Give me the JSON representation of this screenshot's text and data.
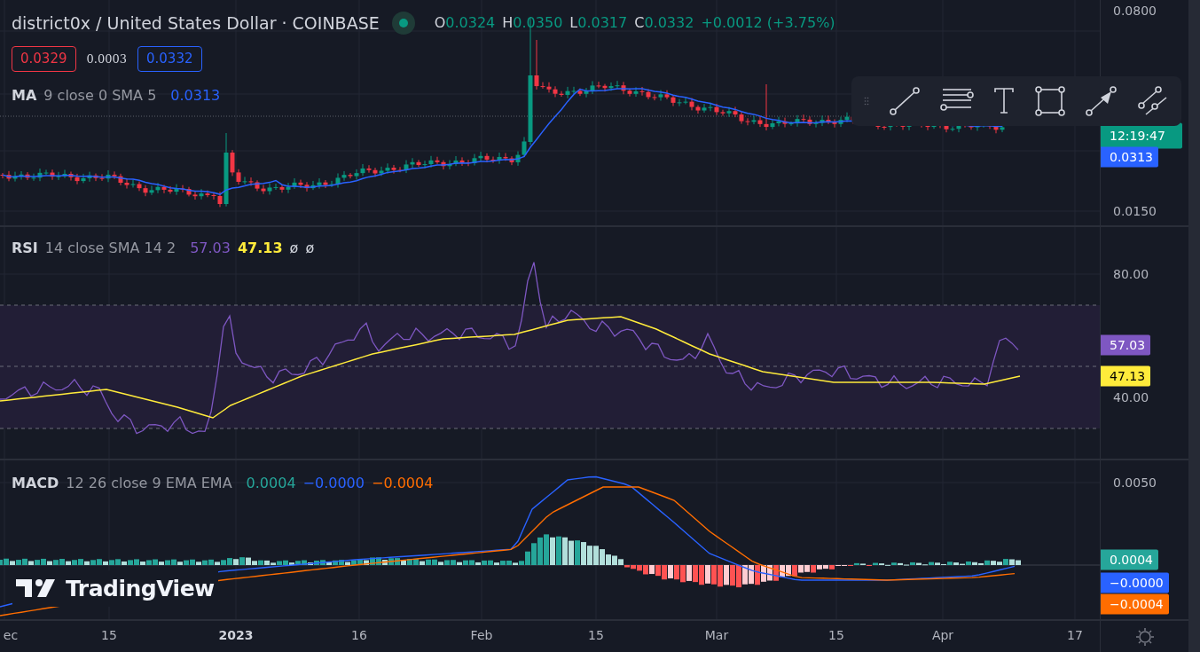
{
  "header": {
    "title": "district0x / United States Dollar · COINBASE",
    "live": true,
    "ohlc": [
      {
        "label": "O",
        "value": "0.0324"
      },
      {
        "label": "H",
        "value": "0.0350"
      },
      {
        "label": "L",
        "value": "0.0317"
      },
      {
        "label": "C",
        "value": "0.0332"
      }
    ],
    "change": "+0.0012 (+3.75%)"
  },
  "quote": {
    "sell": "0.0329",
    "spread": "0.0003",
    "buy": "0.0332"
  },
  "panes": [
    {
      "kind": "price",
      "legend": {
        "name": "MA",
        "params": "9 close 0 SMA 5",
        "values": [
          {
            "text": "0.0313",
            "color": "#2962ff"
          }
        ]
      },
      "axis": {
        "ticks": [
          "0.0800",
          "0.0150"
        ],
        "tags": [
          {
            "text": "12:19:47",
            "color": "#089981"
          },
          {
            "text": "0.0313",
            "color": "#2962ff"
          }
        ]
      }
    },
    {
      "kind": "rsi",
      "legend": {
        "name": "RSI",
        "params": "14 close SMA 14 2",
        "values": [
          {
            "text": "57.03",
            "color": "#7e57c2"
          },
          {
            "text": "47.13",
            "color": "#ffeb3b"
          },
          {
            "text": "ø",
            "color": "#d1d4dc"
          },
          {
            "text": "ø",
            "color": "#d1d4dc"
          }
        ]
      },
      "axis": {
        "ticks": [
          "80.00",
          "40.00"
        ],
        "tags": [
          {
            "text": "57.03",
            "color": "#7e57c2"
          },
          {
            "text": "47.13",
            "color": "#ffeb3b"
          }
        ]
      }
    },
    {
      "kind": "macd",
      "legend": {
        "name": "MACD",
        "params": "12 26 close 9 EMA EMA",
        "values": [
          {
            "text": "0.0004",
            "color": "#26a69a"
          },
          {
            "text": "−0.0000",
            "color": "#2962ff"
          },
          {
            "text": "−0.0004",
            "color": "#ff6d00"
          }
        ]
      },
      "axis": {
        "ticks": [
          "0.0050"
        ],
        "tags": [
          {
            "text": "0.0004",
            "color": "#26a69a"
          },
          {
            "text": "−0.0000",
            "color": "#2962ff"
          },
          {
            "text": "−0.0004",
            "color": "#ff6d00"
          }
        ]
      }
    }
  ],
  "logo": "TradingView",
  "time_axis": [
    {
      "label": "ec",
      "major": false
    },
    {
      "label": "15",
      "major": false
    },
    {
      "label": "2023",
      "major": true
    },
    {
      "label": "16",
      "major": false
    },
    {
      "label": "Feb",
      "major": false
    },
    {
      "label": "15",
      "major": false
    },
    {
      "label": "Mar",
      "major": false
    },
    {
      "label": "15",
      "major": false
    },
    {
      "label": "Apr",
      "major": false
    },
    {
      "label": "17",
      "major": false
    }
  ]
}
